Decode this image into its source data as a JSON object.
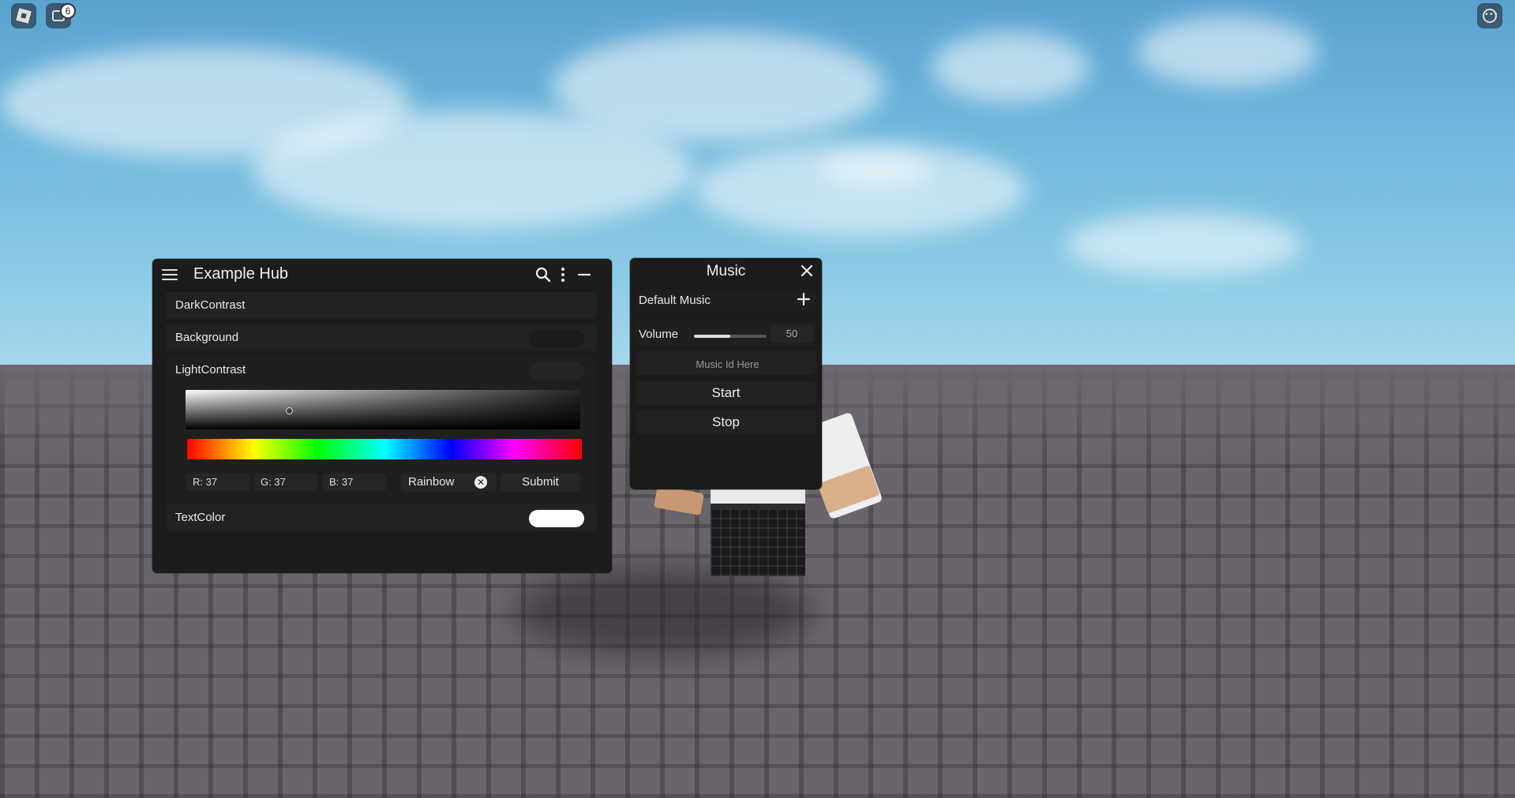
{
  "topbar": {
    "roblox_icon": "roblox-menu-icon",
    "chat_icon": "chat-icon",
    "notification_count": "6",
    "more_icon": "more-icon"
  },
  "hub": {
    "title": "Example Hub",
    "icons": {
      "menu": "hamburger-icon",
      "search": "search-icon",
      "options": "vertical-dots-icon",
      "minimize": "minimize-icon"
    },
    "rows": [
      {
        "label": "DarkContrast"
      },
      {
        "label": "Background",
        "color": "#1c1c1c"
      },
      {
        "label": "LightContrast",
        "color": "#252525"
      },
      {
        "label": "TextColor",
        "color": "#ffffff"
      }
    ],
    "picker": {
      "r": "R: 37",
      "g": "G: 37",
      "b": "B: 37",
      "rainbow_label": "Rainbow",
      "submit_label": "Submit"
    }
  },
  "music": {
    "title": "Music",
    "default_music_label": "Default Music",
    "volume_label": "Volume",
    "volume_value": "50",
    "volume_fraction": 0.5,
    "music_id_placeholder": "Music Id Here",
    "start_label": "Start",
    "stop_label": "Stop"
  },
  "colors": {
    "panel_bg": "#1c1c1c",
    "row_bg": "#222222",
    "text": "#e8e8e8"
  }
}
